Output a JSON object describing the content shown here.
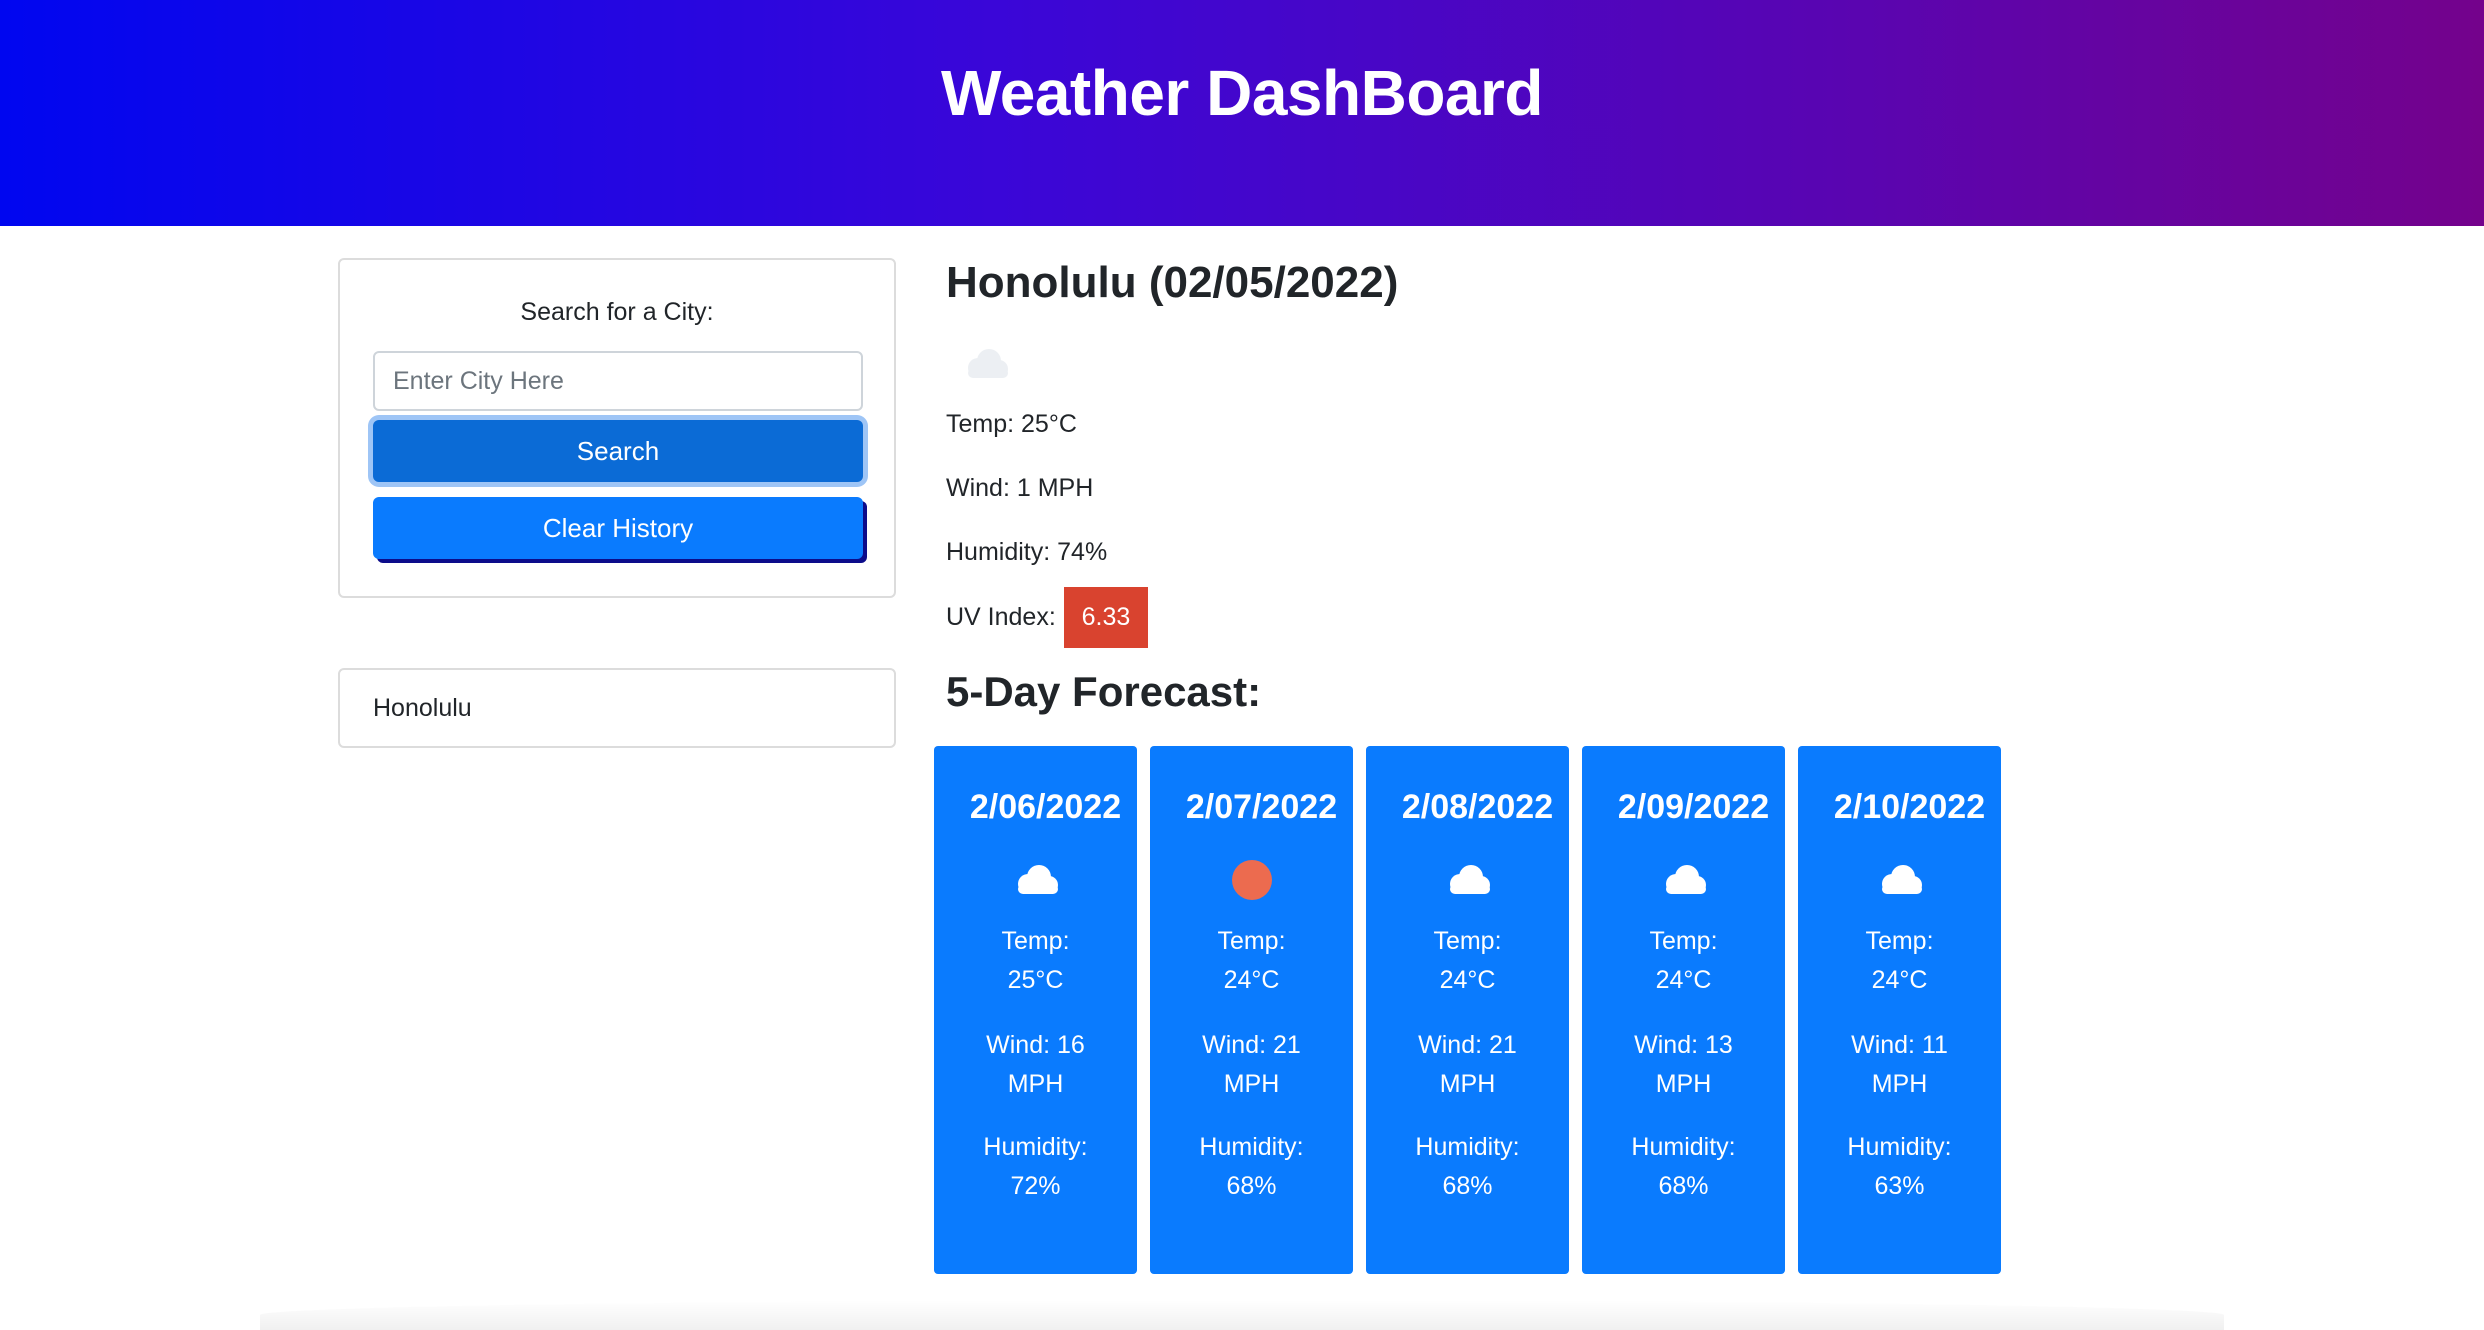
{
  "header": {
    "title": "Weather DashBoard"
  },
  "search": {
    "label": "Search for a City:",
    "placeholder": "Enter City Here",
    "value": "",
    "search_button": "Search",
    "clear_button": "Clear History"
  },
  "history": [
    "Honolulu"
  ],
  "current": {
    "title": "Honolulu (02/05/2022)",
    "icon": "cloud-icon",
    "temp": "Temp: 25°C",
    "wind": "Wind: 1 MPH",
    "humidity": "Humidity: 74%",
    "uv_label": "UV Index:",
    "uv_value": "6.33",
    "uv_color": "#d9432f"
  },
  "forecast": {
    "title": "5-Day Forecast:",
    "temp_label": "Temp:",
    "wind_label": "Wind:",
    "humidity_label": "Humidity:",
    "days": [
      {
        "date": "2/06/2022",
        "icon": "cloud-icon",
        "temp": "25°C",
        "wind_value": "16",
        "wind_unit": "MPH",
        "humidity": "72%"
      },
      {
        "date": "2/07/2022",
        "icon": "sun-icon",
        "temp": "24°C",
        "wind_value": "21",
        "wind_unit": "MPH",
        "humidity": "68%"
      },
      {
        "date": "2/08/2022",
        "icon": "cloud-icon",
        "temp": "24°C",
        "wind_value": "21",
        "wind_unit": "MPH",
        "humidity": "68%"
      },
      {
        "date": "2/09/2022",
        "icon": "cloud-icon",
        "temp": "24°C",
        "wind_value": "13",
        "wind_unit": "MPH",
        "humidity": "68%"
      },
      {
        "date": "2/10/2022",
        "icon": "cloud-icon",
        "temp": "24°C",
        "wind_value": "11",
        "wind_unit": "MPH",
        "humidity": "63%"
      }
    ]
  },
  "colors": {
    "header_gradient_start": "#0006f0",
    "header_gradient_end": "#74028c",
    "card_blue": "#0a7bfe",
    "search_button": "#0b6bd6"
  }
}
